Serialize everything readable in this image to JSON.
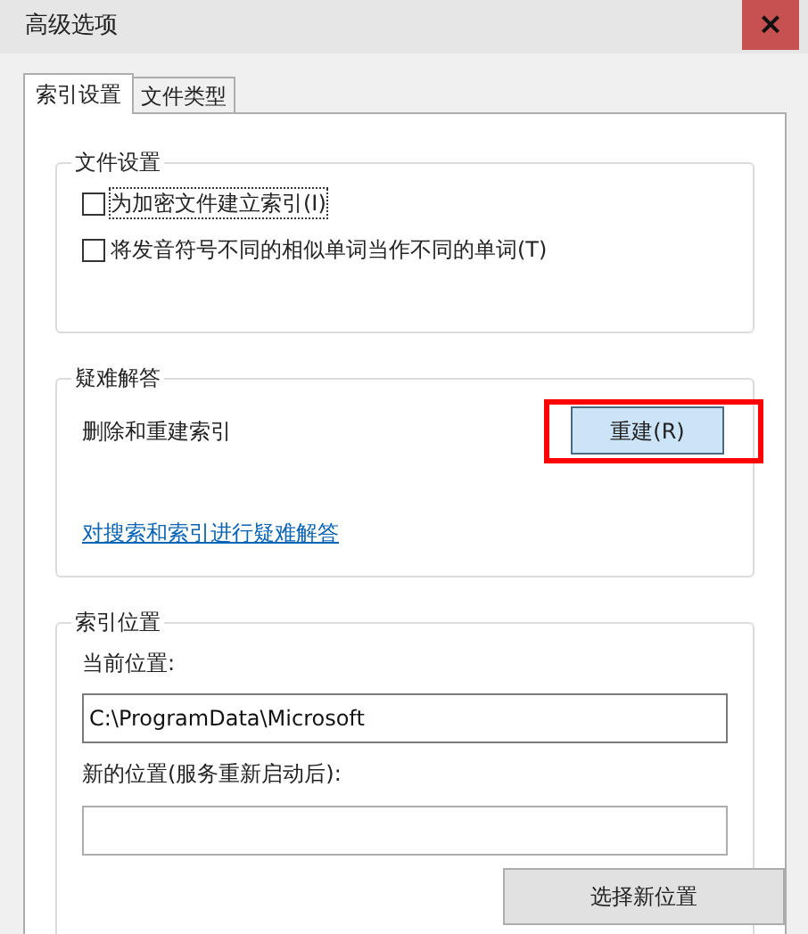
{
  "window": {
    "title": "高级选项",
    "close": "×"
  },
  "tabs": [
    {
      "label": "索引设置",
      "selected": true
    },
    {
      "label": "文件类型",
      "selected": false
    }
  ],
  "file_settings": {
    "title": "文件设置",
    "options": [
      {
        "label": "为加密文件建立索引(I)",
        "checked": false,
        "focused": true
      },
      {
        "label": "将发音符号不同的相似单词当作不同的单词(T)",
        "checked": false,
        "focused": false
      }
    ]
  },
  "troubleshooting": {
    "title": "疑难解答",
    "label": "删除和重建索引",
    "button": "重建(R)",
    "highlighted": true,
    "link": "对搜索和索引进行疑难解答"
  },
  "index_location": {
    "title": "索引位置",
    "current_label": "当前位置:",
    "current_value": "C:\\ProgramData\\Microsoft",
    "new_label": "新的位置(服务重新启动后):",
    "button": "选择新位置"
  }
}
